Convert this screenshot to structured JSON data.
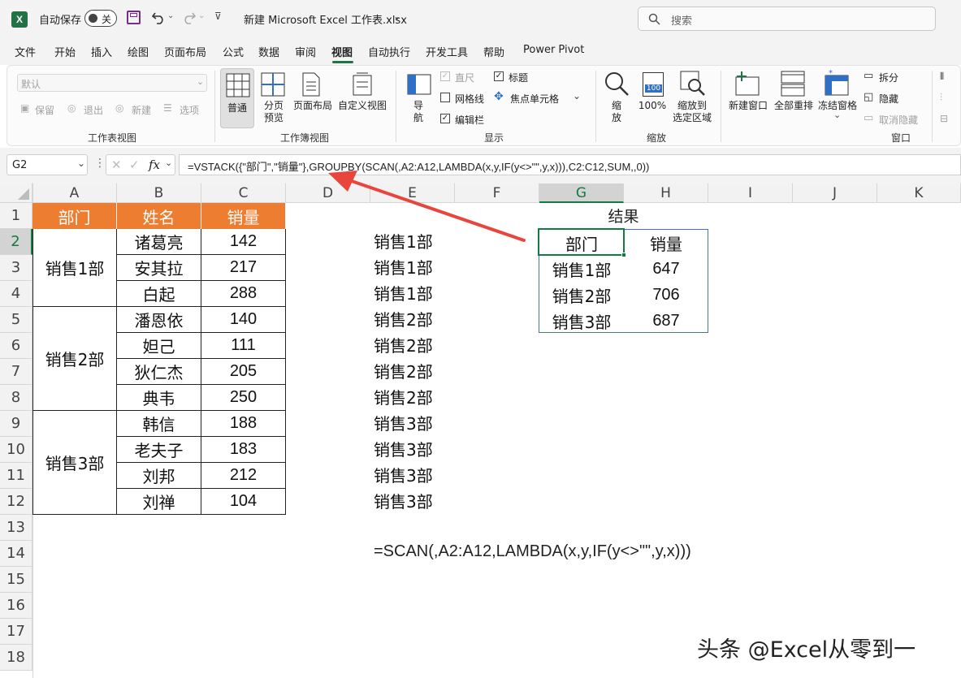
{
  "titlebar": {
    "autosave_label": "自动保存",
    "autosave_state": "关",
    "filename": "新建 Microsoft Excel 工作表.xlsx",
    "search_placeholder": "搜索"
  },
  "tabs": [
    "文件",
    "开始",
    "插入",
    "绘图",
    "页面布局",
    "公式",
    "数据",
    "审阅",
    "视图",
    "自动执行",
    "开发工具",
    "帮助",
    "Power Pivot"
  ],
  "active_tab": "视图",
  "ribbon": {
    "sheetview": {
      "dropdown_value": "默认",
      "keep": "保留",
      "exit": "退出",
      "new": "新建",
      "options": "选项",
      "label": "工作表视图"
    },
    "workbookview": {
      "normal": "普通",
      "pagebreak_line1": "分页",
      "pagebreak_line2": "预览",
      "pagelayout": "页面布局",
      "custom": "自定义视图",
      "label": "工作簿视图"
    },
    "show": {
      "nav_line1": "导",
      "nav_line2": "航",
      "ruler": "直尺",
      "gridlines": "网格线",
      "formulabar": "编辑栏",
      "headings": "标题",
      "focus": "焦点单元格",
      "label": "显示"
    },
    "zoom": {
      "zoom_line1": "缩",
      "zoom_line2": "放",
      "hundred": "100%",
      "hundred_icon_text": "100",
      "selection_line1": "缩放到",
      "selection_line2": "选定区域",
      "label": "缩放"
    },
    "window": {
      "newwindow": "新建窗口",
      "arrange": "全部重排",
      "freeze": "冻结窗格",
      "split": "拆分",
      "hide": "隐藏",
      "unhide": "取消隐藏",
      "label": "窗口"
    }
  },
  "formulabar": {
    "namebox": "G2",
    "fx": "fx",
    "formula": "=VSTACK({\"部门\",\"销量\"},GROUPBY(SCAN(,A2:A12,LAMBDA(x,y,IF(y<>\"\",y,x))),C2:C12,SUM,,0))"
  },
  "columns": [
    "A",
    "B",
    "C",
    "D",
    "E",
    "F",
    "G",
    "H",
    "I",
    "J",
    "K"
  ],
  "rows": [
    "1",
    "2",
    "3",
    "4",
    "5",
    "6",
    "7",
    "8",
    "9",
    "10",
    "11",
    "12",
    "13",
    "14",
    "15",
    "16",
    "17",
    "18"
  ],
  "table": {
    "headers": [
      "部门",
      "姓名",
      "销量"
    ],
    "departments": [
      "销售1部",
      "销售2部",
      "销售3部"
    ],
    "names": [
      "诸葛亮",
      "安其拉",
      "白起",
      "潘恩依",
      "妲己",
      "狄仁杰",
      "典韦",
      "韩信",
      "老夫子",
      "刘邦",
      "刘禅"
    ],
    "sales": [
      "142",
      "217",
      "288",
      "140",
      "111",
      "205",
      "250",
      "188",
      "183",
      "212",
      "104"
    ]
  },
  "scan_results": [
    "销售1部",
    "销售1部",
    "销售1部",
    "销售2部",
    "销售2部",
    "销售2部",
    "销售2部",
    "销售3部",
    "销售3部",
    "销售3部",
    "销售3部"
  ],
  "scan_formula": "=SCAN(,A2:A12,LAMBDA(x,y,IF(y<>\"\",y,x)))",
  "result": {
    "title": "结果",
    "headers": [
      "部门",
      "销量"
    ],
    "rows": [
      [
        "销售1部",
        "647"
      ],
      [
        "销售2部",
        "706"
      ],
      [
        "销售3部",
        "687"
      ]
    ]
  },
  "watermark": "头条 @Excel从零到一",
  "colors": {
    "header_fill": "#ED7D31",
    "excel_green": "#217346",
    "arrow": "#E8453C",
    "selection_border": "#107C41",
    "result_border": "#4472C4"
  }
}
